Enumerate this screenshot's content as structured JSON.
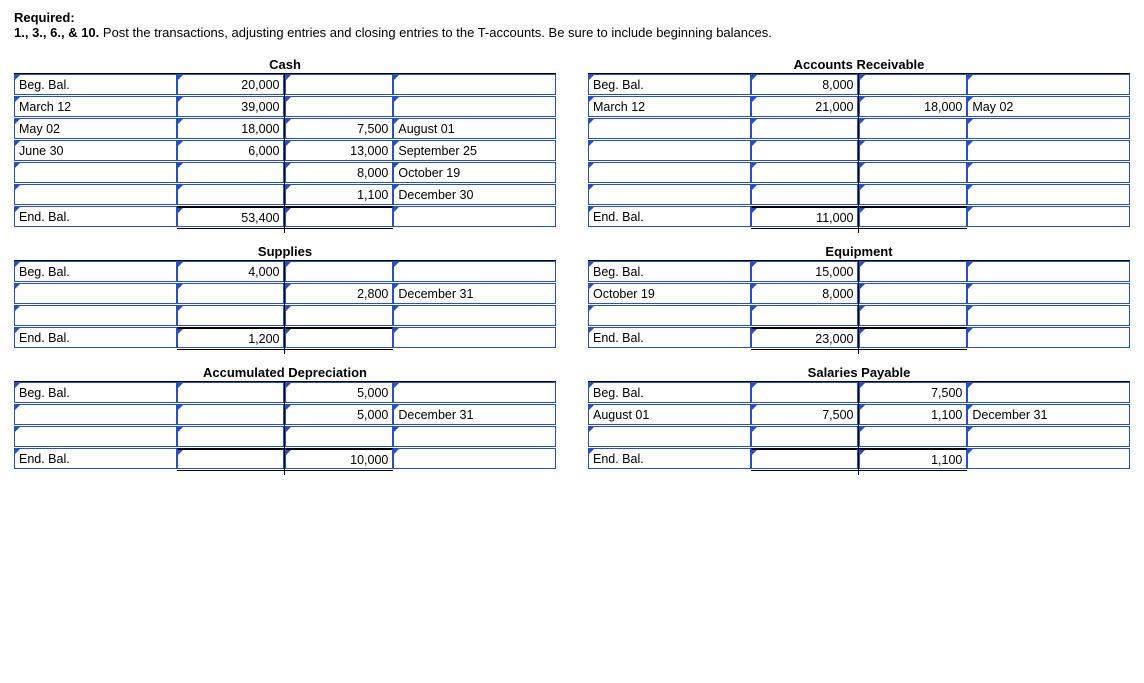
{
  "header": {
    "required": "Required:",
    "instructions_bold": "1., 3., 6., & 10.",
    "instructions_rest": " Post the transactions, adjusting entries and closing entries to the T-accounts. Be sure to include beginning balances."
  },
  "accounts": {
    "cash": {
      "title": "Cash",
      "rows": [
        {
          "ll": "Beg. Bal.",
          "la": "20,000",
          "ra": "",
          "rl": ""
        },
        {
          "ll": "March 12",
          "la": "39,000",
          "ra": "",
          "rl": ""
        },
        {
          "ll": "May 02",
          "la": "18,000",
          "ra": "7,500",
          "rl": "August 01"
        },
        {
          "ll": "June 30",
          "la": "6,000",
          "ra": "13,000",
          "rl": "September 25"
        },
        {
          "ll": "",
          "la": "",
          "ra": "8,000",
          "rl": "October 19"
        },
        {
          "ll": "",
          "la": "",
          "ra": "1,100",
          "rl": "December 30"
        }
      ],
      "end": {
        "ll": "End. Bal.",
        "la": "53,400",
        "ra": "",
        "rl": ""
      }
    },
    "ar": {
      "title": "Accounts Receivable",
      "rows": [
        {
          "ll": "Beg. Bal.",
          "la": "8,000",
          "ra": "",
          "rl": ""
        },
        {
          "ll": "March 12",
          "la": "21,000",
          "ra": "18,000",
          "rl": "May 02"
        },
        {
          "ll": "",
          "la": "",
          "ra": "",
          "rl": ""
        },
        {
          "ll": "",
          "la": "",
          "ra": "",
          "rl": ""
        },
        {
          "ll": "",
          "la": "",
          "ra": "",
          "rl": ""
        },
        {
          "ll": "",
          "la": "",
          "ra": "",
          "rl": ""
        }
      ],
      "end": {
        "ll": "End. Bal.",
        "la": "11,000",
        "ra": "",
        "rl": ""
      }
    },
    "supplies": {
      "title": "Supplies",
      "rows": [
        {
          "ll": "Beg. Bal.",
          "la": "4,000",
          "ra": "",
          "rl": ""
        },
        {
          "ll": "",
          "la": "",
          "ra": "2,800",
          "rl": "December 31"
        },
        {
          "ll": "",
          "la": "",
          "ra": "",
          "rl": ""
        }
      ],
      "end": {
        "ll": "End. Bal.",
        "la": "1,200",
        "ra": "",
        "rl": ""
      }
    },
    "equipment": {
      "title": "Equipment",
      "rows": [
        {
          "ll": "Beg. Bal.",
          "la": "15,000",
          "ra": "",
          "rl": ""
        },
        {
          "ll": "October 19",
          "la": "8,000",
          "ra": "",
          "rl": ""
        },
        {
          "ll": "",
          "la": "",
          "ra": "",
          "rl": ""
        }
      ],
      "end": {
        "ll": "End. Bal.",
        "la": "23,000",
        "ra": "",
        "rl": ""
      }
    },
    "accdep": {
      "title": "Accumulated Depreciation",
      "rows": [
        {
          "ll": "Beg. Bal.",
          "la": "",
          "ra": "5,000",
          "rl": ""
        },
        {
          "ll": "",
          "la": "",
          "ra": "5,000",
          "rl": "December 31"
        },
        {
          "ll": "",
          "la": "",
          "ra": "",
          "rl": ""
        }
      ],
      "end": {
        "ll": "End. Bal.",
        "la": "",
        "ra": "10,000",
        "rl": ""
      }
    },
    "salpay": {
      "title": "Salaries Payable",
      "rows": [
        {
          "ll": "Beg. Bal.",
          "la": "",
          "ra": "7,500",
          "rl": ""
        },
        {
          "ll": "August 01",
          "la": "7,500",
          "ra": "1,100",
          "rl": "December 31"
        },
        {
          "ll": "",
          "la": "",
          "ra": "",
          "rl": ""
        }
      ],
      "end": {
        "ll": "End. Bal.",
        "la": "",
        "ra": "1,100",
        "rl": ""
      }
    }
  }
}
